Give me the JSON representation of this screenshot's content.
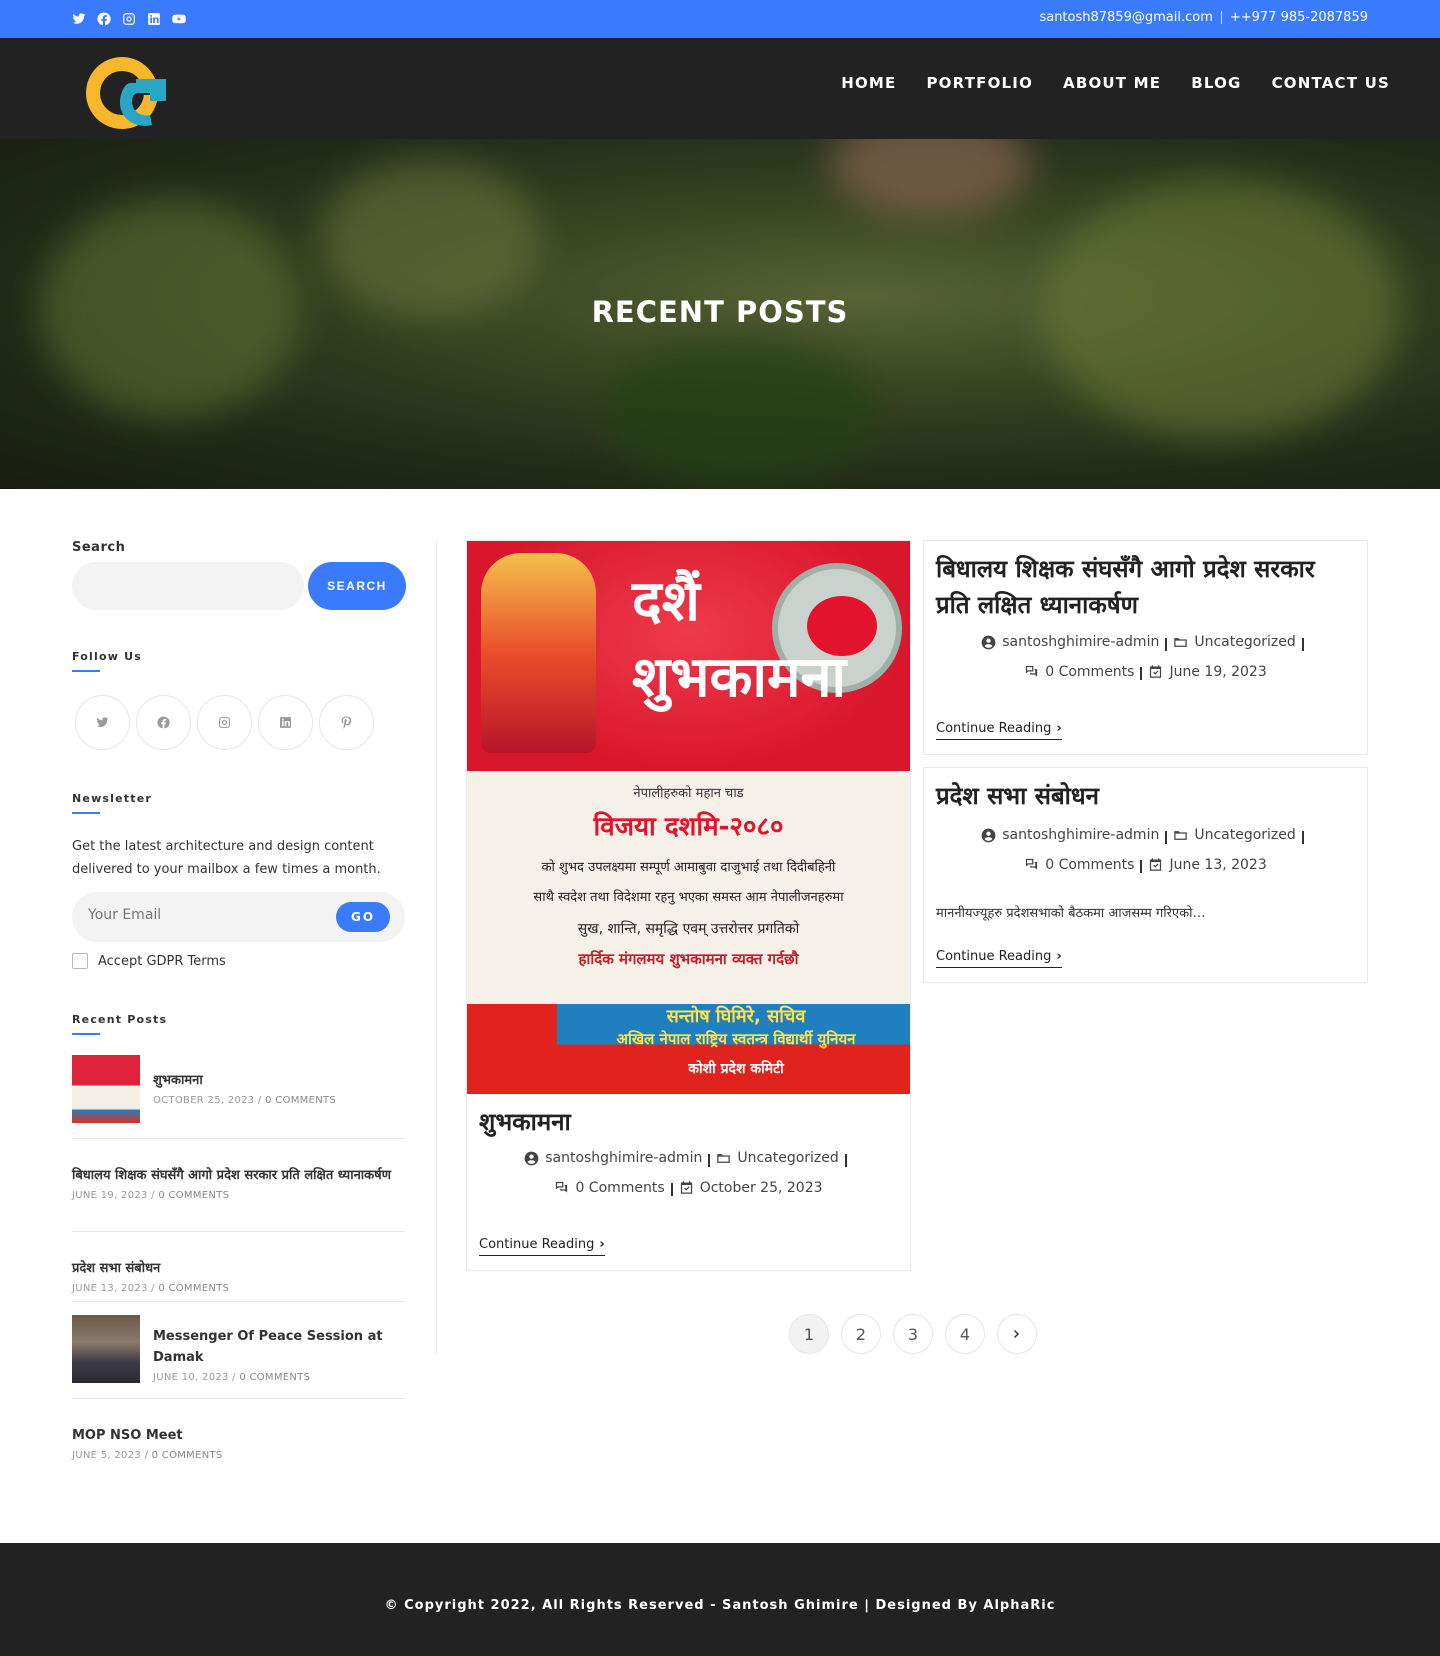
{
  "topbar": {
    "email": "santosh87859@gmail.com",
    "phone": "++977 985-2087859",
    "social_icons": [
      "twitter-icon",
      "facebook-icon",
      "instagram-icon",
      "linkedin-icon",
      "youtube-icon"
    ]
  },
  "nav": {
    "items": [
      {
        "label": "HOME"
      },
      {
        "label": "PORTFOLIO"
      },
      {
        "label": "ABOUT ME"
      },
      {
        "label": "BLOG"
      },
      {
        "label": "CONTACT US"
      }
    ]
  },
  "hero": {
    "title": "RECENT POSTS"
  },
  "sidebar": {
    "search": {
      "label": "Search",
      "placeholder": "",
      "button": "SEARCH"
    },
    "follow": {
      "title": "Follow Us",
      "icons": [
        "twitter-icon",
        "facebook-icon",
        "instagram-icon",
        "linkedin-icon",
        "pinterest-icon"
      ]
    },
    "newsletter": {
      "title": "Newsletter",
      "text": "Get the latest architecture and design content delivered to your mailbox a few times a month.",
      "placeholder": "Your Email",
      "button": "GO",
      "gdpr": "Accept GDPR Terms"
    },
    "recent_posts": {
      "title": "Recent Posts",
      "items": [
        {
          "title": "शुभकामना",
          "date": "OCTOBER 25, 2023",
          "comments": "0 COMMENTS"
        },
        {
          "title": "बिधालय शिक्षक संघसँगै आगो प्रदेश सरकार प्रति लक्षित ध्यानाकर्षण",
          "date": "JUNE 19, 2023",
          "comments": "0 COMMENTS"
        },
        {
          "title": "प्रदेश सभा संबोधन",
          "date": "JUNE 13, 2023",
          "comments": "0 COMMENTS"
        },
        {
          "title": "Messenger Of Peace Session at Damak",
          "date": "JUNE 10, 2023",
          "comments": "0 COMMENTS"
        },
        {
          "title": "MOP NSO Meet",
          "date": "JUNE 5, 2023",
          "comments": "0 COMMENTS"
        }
      ]
    }
  },
  "posts": [
    {
      "title": "शुभकामना",
      "author": "santoshghimire-admin",
      "category": "Uncategorized",
      "comments": "0 Comments",
      "date": "October 25, 2023",
      "continue": "Continue Reading",
      "image": {
        "header": "दशैं शुभकामना",
        "line1": "नेपालीहरुको महान चाड",
        "line2": "विजया दशमि-२०८०",
        "line3": "को शुभद उपलक्ष्यमा सम्पूर्ण आमाबुवा दाजुभाई तथा दिदीबहिनी",
        "line4": "साथै स्वदेश तथा विदेशमा रहनु भएका समस्त आम नेपालीजनहरुमा",
        "line5": "सुख, शान्ति, समृद्धि एवम् उत्तरोत्तर प्रगतिको",
        "line6": "हार्दिक मंगलमय शुभकामना व्यक्त गर्दछौ",
        "footer1": "सन्तोष घिमिरे, सचिव",
        "footer2": "अखिल नेपाल राष्ट्रिय स्वतन्त्र विद्यार्थी युनियन",
        "footer3": "कोशी प्रदेश कमिटी"
      }
    },
    {
      "title": "बिधालय शिक्षक संघसँगै आगो प्रदेश सरकार प्रति लक्षित ध्यानाकर्षण",
      "author": "santoshghimire-admin",
      "category": "Uncategorized",
      "comments": "0 Comments",
      "date": "June 19, 2023",
      "continue": "Continue Reading"
    },
    {
      "title": "प्रदेश सभा संबोधन",
      "author": "santoshghimire-admin",
      "category": "Uncategorized",
      "comments": "0 Comments",
      "date": "June 13, 2023",
      "excerpt": "माननीयज्यूहरु प्रदेशसभाको बैठकमा आजसम्म गरिएको…",
      "continue": "Continue Reading"
    }
  ],
  "pagination": {
    "pages": [
      "1",
      "2",
      "3",
      "4"
    ],
    "current": "1"
  },
  "footer": {
    "copyright": "© Copyright 2022, All Rights Reserved - Santosh Ghimire | Designed By  AlphaRic"
  },
  "colors": {
    "accent": "#3a7bfd",
    "header_bg": "#222222",
    "logo_orange": "#f7b72d",
    "logo_teal": "#29a6c6"
  }
}
